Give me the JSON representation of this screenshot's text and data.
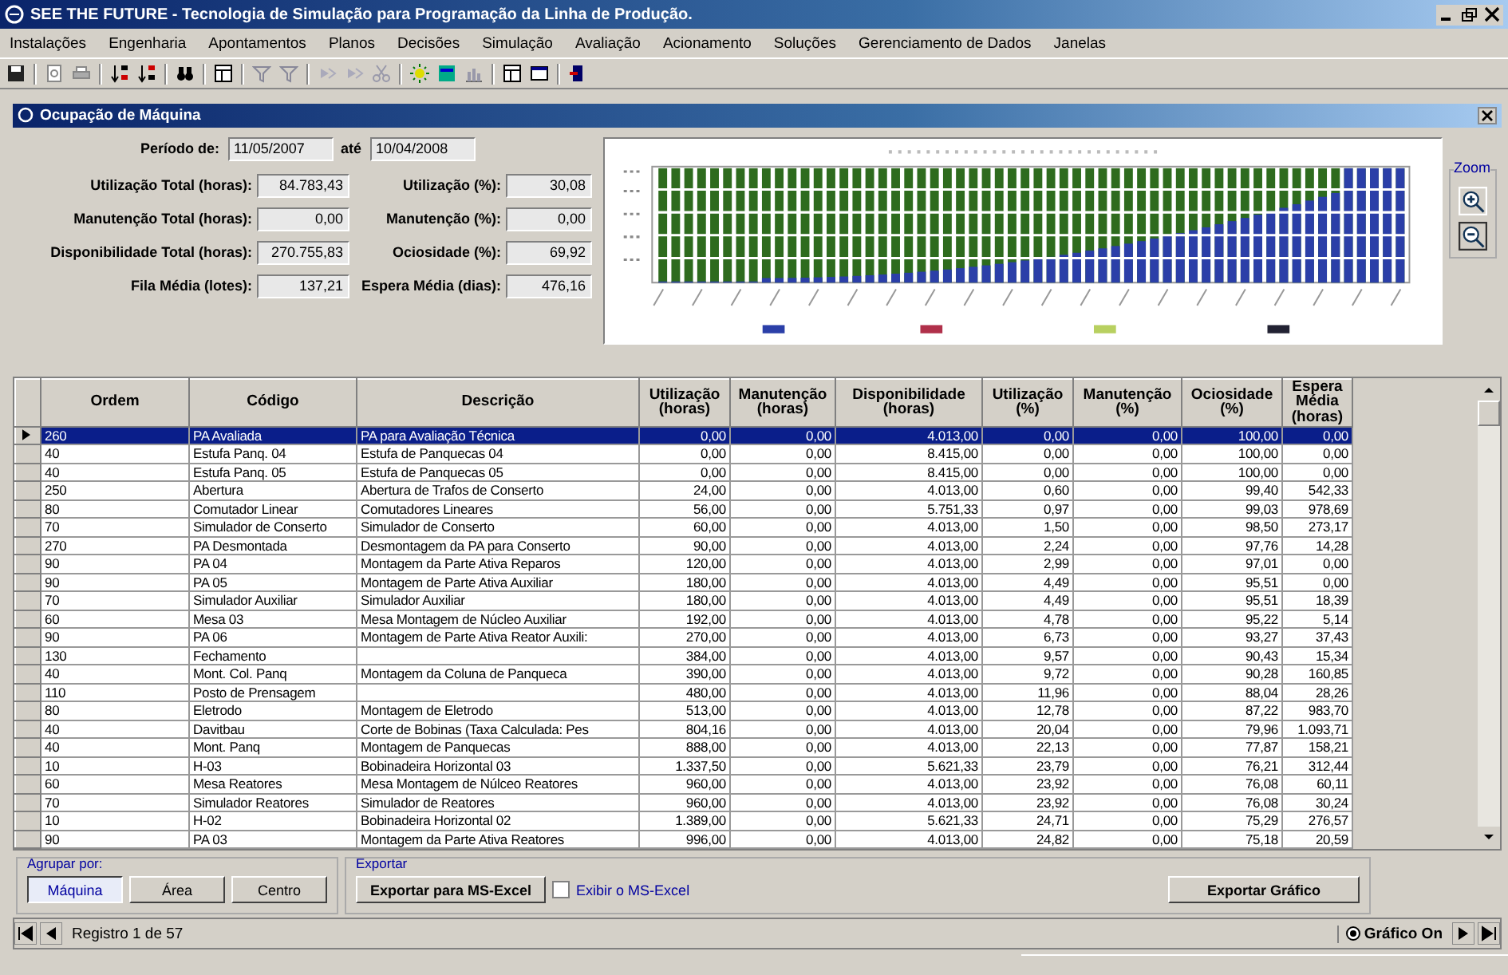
{
  "window": {
    "title": "SEE THE FUTURE - Tecnologia de Simulação para Programação da Linha de Produção."
  },
  "menu": [
    "Instalações",
    "Engenharia",
    "Apontamentos",
    "Planos",
    "Decisões",
    "Simulação",
    "Avaliação",
    "Acionamento",
    "Soluções",
    "Gerenciamento de Dados",
    "Janelas"
  ],
  "child_window": {
    "title": "Ocupação de Máquina"
  },
  "period": {
    "label": "Período de:",
    "from": "11/05/2007",
    "to_label": "até",
    "to": "10/04/2008"
  },
  "totals": [
    {
      "label": "Utilização Total (horas):",
      "value": "84.783,43"
    },
    {
      "label": "Manutenção Total (horas):",
      "value": "0,00"
    },
    {
      "label": "Disponibilidade Total (horas):",
      "value": "270.755,83"
    },
    {
      "label": "Fila Média (lotes):",
      "value": "137,21"
    }
  ],
  "percents": [
    {
      "label": "Utilização (%):",
      "value": "30,08"
    },
    {
      "label": "Manutenção (%):",
      "value": "0,00"
    },
    {
      "label": "Ociosidade (%):",
      "value": "69,92"
    },
    {
      "label": "Espera Média (dias):",
      "value": "476,16"
    }
  ],
  "zoom": {
    "label": "Zoom"
  },
  "table": {
    "columns": [
      "Ordem",
      "Código",
      "Descrição",
      "Utilização (horas)",
      "Manutenção (horas)",
      "Disponibilidade (horas)",
      "Utilização (%)",
      "Manutenção (%)",
      "Ociosidade (%)",
      "Espera Média (horas)"
    ],
    "rows": [
      {
        "selected": true,
        "cells": [
          "260",
          "PA Avaliada",
          "PA para Avaliação Técnica",
          "0,00",
          "0,00",
          "4.013,00",
          "0,00",
          "0,00",
          "100,00",
          "0,00"
        ]
      },
      {
        "selected": false,
        "cells": [
          "40",
          "Estufa Panq. 04",
          "Estufa de Panquecas 04",
          "0,00",
          "0,00",
          "8.415,00",
          "0,00",
          "0,00",
          "100,00",
          "0,00"
        ]
      },
      {
        "selected": false,
        "cells": [
          "40",
          "Estufa Panq. 05",
          "Estufa de Panquecas 05",
          "0,00",
          "0,00",
          "8.415,00",
          "0,00",
          "0,00",
          "100,00",
          "0,00"
        ]
      },
      {
        "selected": false,
        "cells": [
          "250",
          "Abertura",
          "Abertura de Trafos de Conserto",
          "24,00",
          "0,00",
          "4.013,00",
          "0,60",
          "0,00",
          "99,40",
          "542,33"
        ]
      },
      {
        "selected": false,
        "cells": [
          "80",
          "Comutador Linear",
          "Comutadores Lineares",
          "56,00",
          "0,00",
          "5.751,33",
          "0,97",
          "0,00",
          "99,03",
          "978,69"
        ]
      },
      {
        "selected": false,
        "cells": [
          "70",
          "Simulador de Conserto",
          "Simulador de Conserto",
          "60,00",
          "0,00",
          "4.013,00",
          "1,50",
          "0,00",
          "98,50",
          "273,17"
        ]
      },
      {
        "selected": false,
        "cells": [
          "270",
          "PA Desmontada",
          "Desmontagem da PA para Conserto",
          "90,00",
          "0,00",
          "4.013,00",
          "2,24",
          "0,00",
          "97,76",
          "14,28"
        ]
      },
      {
        "selected": false,
        "cells": [
          "90",
          "PA 04",
          "Montagem da Parte Ativa Reparos",
          "120,00",
          "0,00",
          "4.013,00",
          "2,99",
          "0,00",
          "97,01",
          "0,00"
        ]
      },
      {
        "selected": false,
        "cells": [
          "90",
          "PA 05",
          "Montagem de Parte Ativa Auxiliar",
          "180,00",
          "0,00",
          "4.013,00",
          "4,49",
          "0,00",
          "95,51",
          "0,00"
        ]
      },
      {
        "selected": false,
        "cells": [
          "70",
          "Simulador Auxiliar",
          "Simulador Auxiliar",
          "180,00",
          "0,00",
          "4.013,00",
          "4,49",
          "0,00",
          "95,51",
          "18,39"
        ]
      },
      {
        "selected": false,
        "cells": [
          "60",
          "Mesa 03",
          "Mesa Montagem de Núcleo Auxiliar",
          "192,00",
          "0,00",
          "4.013,00",
          "4,78",
          "0,00",
          "95,22",
          "5,14"
        ]
      },
      {
        "selected": false,
        "cells": [
          "90",
          "PA 06",
          "Montagem de Parte Ativa Reator Auxili:",
          "270,00",
          "0,00",
          "4.013,00",
          "6,73",
          "0,00",
          "93,27",
          "37,43"
        ]
      },
      {
        "selected": false,
        "cells": [
          "130",
          "Fechamento",
          null,
          "384,00",
          "0,00",
          "4.013,00",
          "9,57",
          "0,00",
          "90,43",
          "15,34"
        ]
      },
      {
        "selected": false,
        "cells": [
          "40",
          "Mont. Col. Panq",
          "Montagem da Coluna de Panqueca",
          "390,00",
          "0,00",
          "4.013,00",
          "9,72",
          "0,00",
          "90,28",
          "160,85"
        ]
      },
      {
        "selected": false,
        "cells": [
          "110",
          "Posto de Prensagem",
          null,
          "480,00",
          "0,00",
          "4.013,00",
          "11,96",
          "0,00",
          "88,04",
          "28,26"
        ]
      },
      {
        "selected": false,
        "cells": [
          "80",
          "Eletrodo",
          "Montagem de Eletrodo",
          "513,00",
          "0,00",
          "4.013,00",
          "12,78",
          "0,00",
          "87,22",
          "983,70"
        ]
      },
      {
        "selected": false,
        "cells": [
          "40",
          "Davitbau",
          "Corte de Bobinas (Taxa Calculada: Pes",
          "804,16",
          "0,00",
          "4.013,00",
          "20,04",
          "0,00",
          "79,96",
          "1.093,71"
        ]
      },
      {
        "selected": false,
        "cells": [
          "40",
          "Mont. Panq",
          "Montagem de Panquecas",
          "888,00",
          "0,00",
          "4.013,00",
          "22,13",
          "0,00",
          "77,87",
          "158,21"
        ]
      },
      {
        "selected": false,
        "cells": [
          "10",
          "H-03",
          "Bobinadeira Horizontal 03",
          "1.337,50",
          "0,00",
          "5.621,33",
          "23,79",
          "0,00",
          "76,21",
          "312,44"
        ]
      },
      {
        "selected": false,
        "cells": [
          "60",
          "Mesa Reatores",
          "Mesa Montagem de Núlceo Reatores",
          "960,00",
          "0,00",
          "4.013,00",
          "23,92",
          "0,00",
          "76,08",
          "60,11"
        ]
      },
      {
        "selected": false,
        "cells": [
          "70",
          "Simulador Reatores",
          "Simulador de Reatores",
          "960,00",
          "0,00",
          "4.013,00",
          "23,92",
          "0,00",
          "76,08",
          "30,24"
        ]
      },
      {
        "selected": false,
        "cells": [
          "10",
          "H-02",
          "Bobinadeira Horizontal 02",
          "1.389,00",
          "0,00",
          "5.621,33",
          "24,71",
          "0,00",
          "75,29",
          "276,57"
        ]
      },
      {
        "selected": false,
        "cells": [
          "90",
          "PA 03",
          "Montagem da Parte Ativa Reatores",
          "996,00",
          "0,00",
          "4.013,00",
          "24,82",
          "0,00",
          "75,18",
          "20,59"
        ]
      }
    ]
  },
  "group_by": {
    "label": "Agrupar por:",
    "options": [
      {
        "label": "Máquina",
        "selected": true
      },
      {
        "label": "Área",
        "selected": false
      },
      {
        "label": "Centro",
        "selected": false
      }
    ]
  },
  "export": {
    "label": "Exportar",
    "excel_button": "Exportar para MS-Excel",
    "show_excel": {
      "label": "Exibir o MS-Excel",
      "checked": false
    },
    "chart_button": "Exportar Gráfico"
  },
  "navigator": {
    "record": "Registro 1 de 57",
    "chart_toggle": {
      "label": "Gráfico On",
      "on": true
    }
  }
}
